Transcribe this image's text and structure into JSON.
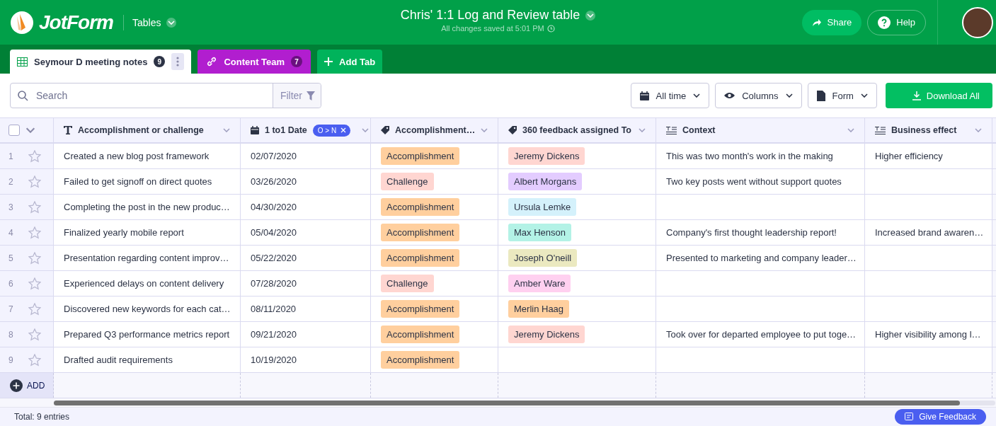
{
  "header": {
    "logo": "JotForm",
    "product": "Tables",
    "title": "Chris' 1:1 Log and Review table",
    "saved": "All changes saved at 5:01 PM",
    "share": "Share",
    "help": "Help"
  },
  "tabs": [
    {
      "label": "Seymour D meeting notes",
      "count": "9",
      "selected": true,
      "kind": "table"
    },
    {
      "label": "Content Team",
      "count": "7",
      "selected": false,
      "kind": "link"
    }
  ],
  "add_tab": "Add Tab",
  "toolbar": {
    "search_placeholder": "Search",
    "filter": "Filter",
    "date_range": "All time",
    "columns": "Columns",
    "form": "Form",
    "download": "Download All"
  },
  "table": {
    "all_checked": false,
    "columns": [
      {
        "label": "Accomplishment or challenge",
        "kind": "text"
      },
      {
        "label": "1 to1 Date",
        "kind": "date",
        "sort": "O > N"
      },
      {
        "label": "Accomplishment…",
        "kind": "tag"
      },
      {
        "label": "360 feedback assigned To",
        "kind": "tag"
      },
      {
        "label": "Context",
        "kind": "longtext"
      },
      {
        "label": "Business effect",
        "kind": "longtext"
      }
    ],
    "rows": [
      {
        "number": "1",
        "starred": false,
        "cells": [
          "Created a new blog post framework",
          "02/07/2020",
          {
            "text": "Accomplishment",
            "color": "#ffcf9e"
          },
          {
            "text": "Jeremy Dickens",
            "color": "#ffd6d1"
          },
          "This was two month's work in the making",
          "Higher efficiency"
        ]
      },
      {
        "number": "2",
        "starred": false,
        "cells": [
          "Failed to get signoff on direct quotes",
          "03/26/2020",
          {
            "text": "Challenge",
            "color": "#ffd6d1"
          },
          {
            "text": "Albert Morgans",
            "color": "#e3ccff"
          },
          "Two key posts went without support quotes",
          null
        ]
      },
      {
        "number": "3",
        "starred": false,
        "cells": [
          "Completing the post in the new produc…",
          "04/30/2020",
          {
            "text": "Accomplishment",
            "color": "#ffcf9e"
          },
          {
            "text": "Ursula Lemke",
            "color": "#d4f1fb"
          },
          null,
          null
        ]
      },
      {
        "number": "4",
        "starred": false,
        "cells": [
          "Finalized yearly mobile report",
          "05/04/2020",
          {
            "text": "Accomplishment",
            "color": "#ffcf9e"
          },
          {
            "text": "Max Henson",
            "color": "#b3f2e6"
          },
          "Company's first thought leadership report!",
          "Increased brand awaren…"
        ]
      },
      {
        "number": "5",
        "starred": false,
        "cells": [
          "Presentation regarding content improv…",
          "05/22/2020",
          {
            "text": "Accomplishment",
            "color": "#ffcf9e"
          },
          {
            "text": "Joseph O'neill",
            "color": "#ebe9c0"
          },
          "Presented to marketing and company leader…",
          null
        ]
      },
      {
        "number": "6",
        "starred": false,
        "cells": [
          "Experienced delays on content delivery",
          "07/28/2020",
          {
            "text": "Challenge",
            "color": "#ffd6d1"
          },
          {
            "text": "Amber Ware",
            "color": "#ffd0f0"
          },
          null,
          null
        ]
      },
      {
        "number": "7",
        "starred": false,
        "cells": [
          "Discovered new keywords for each cat…",
          "08/11/2020",
          {
            "text": "Accomplishment",
            "color": "#ffcf9e"
          },
          {
            "text": "Merlin Haag",
            "color": "#ffcf9e"
          },
          null,
          null
        ]
      },
      {
        "number": "8",
        "starred": false,
        "cells": [
          "Prepared Q3 performance metrics report",
          "09/21/2020",
          {
            "text": "Accomplishment",
            "color": "#ffcf9e"
          },
          {
            "text": "Jeremy Dickens",
            "color": "#ffd6d1"
          },
          "Took over for departed employee to put toge…",
          "Higher visibility among l…"
        ]
      },
      {
        "number": "9",
        "starred": false,
        "cells": [
          "Drafted audit requirements",
          "10/19/2020",
          {
            "text": "Accomplishment",
            "color": "#ffcf9e"
          },
          null,
          null,
          null
        ]
      }
    ],
    "add_row": "ADD"
  },
  "status_bar": {
    "total": "Total: 9 entries",
    "feedback": "Give Feedback"
  }
}
